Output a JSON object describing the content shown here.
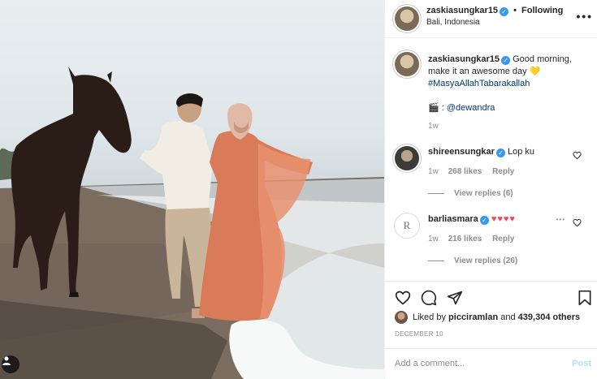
{
  "header": {
    "username": "zaskiasungkar15",
    "follow_sep": "•",
    "follow_label": "Following",
    "location": "Bali, Indonesia"
  },
  "caption": {
    "username": "zaskiasungkar15",
    "text": "Good morning, make it an awesome day",
    "emoji": "💛",
    "hashtag": "#MasyaAllahTabarakallah",
    "credit_icon": "🎬",
    "credit_sep": ":",
    "credit_handle": "@dewandra",
    "time": "1w"
  },
  "comments": [
    {
      "username": "shireensungkar",
      "text": "Lop ku",
      "time": "1w",
      "likes": "268 likes",
      "reply": "Reply",
      "view_replies": "View replies (6)"
    },
    {
      "username": "barliasmara",
      "text": "♥♥♥♥",
      "time": "1w",
      "likes": "216 likes",
      "reply": "Reply",
      "view_replies": "View replies (26)",
      "more": "•••",
      "avatar_letter": "R"
    }
  ],
  "likes": {
    "prefix": "Liked by",
    "user": "picciramlan",
    "and": "and",
    "count": "439,304 others"
  },
  "date": "DECEMBER 10",
  "add_comment": {
    "placeholder": "Add a comment...",
    "post_label": "Post"
  },
  "icons": [
    "verified-icon",
    "more-icon",
    "heart-icon",
    "comment-icon",
    "share-icon",
    "bookmark-icon",
    "tag-user-icon"
  ],
  "colors": {
    "accent": "#3897f0",
    "link": "#00376b",
    "heart_red": "#ed4956",
    "post_disabled": "#b2dffc"
  }
}
